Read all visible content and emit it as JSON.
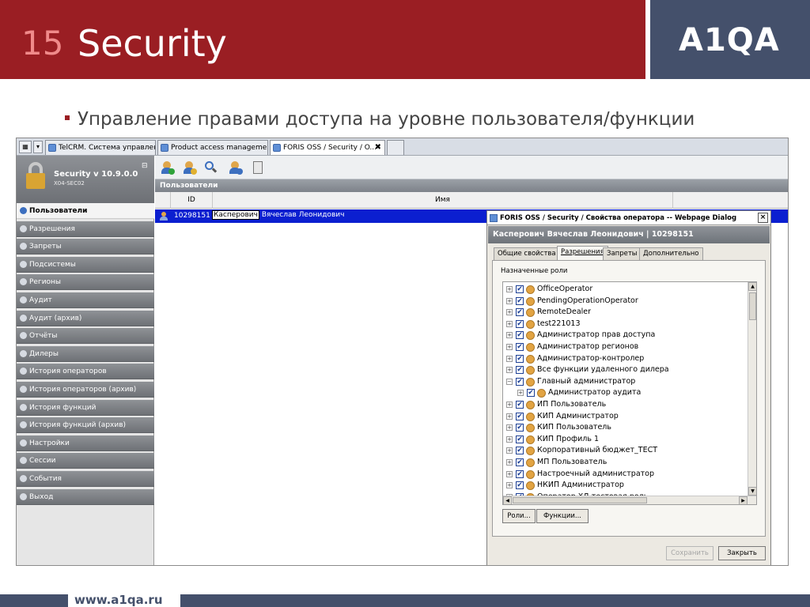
{
  "slide": {
    "number": "15",
    "title": "Security",
    "logo": "A1QA",
    "bullet": "Управление правами доступа на уровне пользователя/функции",
    "footer_url": "www.a1qa.ru"
  },
  "browser": {
    "tabs": [
      {
        "label": "TelCRM. Система управлен..."
      },
      {
        "label": "Product access management"
      },
      {
        "label": "FORIS OSS / Security / O..."
      }
    ],
    "close_glyph": "✖",
    "dropdown_glyph": "▾"
  },
  "app": {
    "title": "Security v 10.9.0.0",
    "subtitle": "X04-SEC02",
    "pin_glyph": "⊟",
    "nav": [
      {
        "label": "Пользователи",
        "selected": true
      },
      {
        "label": "Разрешения"
      },
      {
        "label": "Запреты"
      },
      {
        "label": "Подсистемы"
      },
      {
        "label": "Регионы"
      },
      {
        "label": "Аудит"
      },
      {
        "label": "Аудит (архив)"
      },
      {
        "label": "Отчёты"
      },
      {
        "label": "Дилеры"
      },
      {
        "label": "История операторов"
      },
      {
        "label": "История операторов (архив)"
      },
      {
        "label": "История функций"
      },
      {
        "label": "История функций (архив)"
      },
      {
        "label": "Настройки"
      },
      {
        "label": "Сессии"
      },
      {
        "label": "События"
      },
      {
        "label": "Выход"
      }
    ],
    "grid_title": "Пользователи",
    "columns": {
      "id": "ID",
      "name": "Имя"
    },
    "rows": [
      {
        "id": "10298151",
        "name_selected": "Касперович",
        "name_rest": "Вячеслав Леонидович"
      }
    ]
  },
  "dialog": {
    "title": "FORIS OSS / Security / Свойства оператора -- Webpage Dialog",
    "close_glyph": "×",
    "header": "Касперович Вячеслав Леонидович | 10298151",
    "tabs": [
      "Общие свойства",
      "Разрешения",
      "Запреты",
      "Дополнительно"
    ],
    "active_tab": "Разрешения",
    "roles_label": "Назначенные роли",
    "roles": [
      {
        "name": "OfficeOperator",
        "expander": "+",
        "indent": 0
      },
      {
        "name": "PendingOperationOperator",
        "expander": "+",
        "indent": 0
      },
      {
        "name": "RemoteDealer",
        "expander": "+",
        "indent": 0
      },
      {
        "name": "test221013",
        "expander": "+",
        "indent": 0
      },
      {
        "name": "Администратор прав доступа",
        "expander": "+",
        "indent": 0
      },
      {
        "name": "Администратор регионов",
        "expander": "+",
        "indent": 0
      },
      {
        "name": "Администратор-контролер",
        "expander": "+",
        "indent": 0
      },
      {
        "name": "Все функции удаленного дилера",
        "expander": "+",
        "indent": 0
      },
      {
        "name": "Главный администратор",
        "expander": "−",
        "indent": 0
      },
      {
        "name": "Администратор аудита",
        "expander": "+",
        "indent": 1
      },
      {
        "name": "ИП Пользователь",
        "expander": "+",
        "indent": 0
      },
      {
        "name": "КИП Администратор",
        "expander": "+",
        "indent": 0
      },
      {
        "name": "КИП Пользователь",
        "expander": "+",
        "indent": 0
      },
      {
        "name": "КИП Профиль 1",
        "expander": "+",
        "indent": 0
      },
      {
        "name": "Корпоративный бюджет_ТЕСТ",
        "expander": "+",
        "indent": 0
      },
      {
        "name": "МП Пользователь",
        "expander": "+",
        "indent": 0
      },
      {
        "name": "Настроечный администратор",
        "expander": "+",
        "indent": 0
      },
      {
        "name": "НКИП Администратор",
        "expander": "+",
        "indent": 0
      },
      {
        "name": "Оператор ХД тестовая роль",
        "expander": "+",
        "indent": 0
      }
    ],
    "check_glyph": "✔",
    "buttons": {
      "roles": "Роли...",
      "functions": "Функции...",
      "save": "Сохранить",
      "close": "Закрыть"
    },
    "scroll_up": "▲",
    "scroll_down": "▼",
    "scroll_left": "◀",
    "scroll_right": "▶"
  },
  "colors": {
    "header_red": "#9a1e23",
    "header_navy": "#44506b",
    "selection_blue": "#0b1fd0"
  }
}
